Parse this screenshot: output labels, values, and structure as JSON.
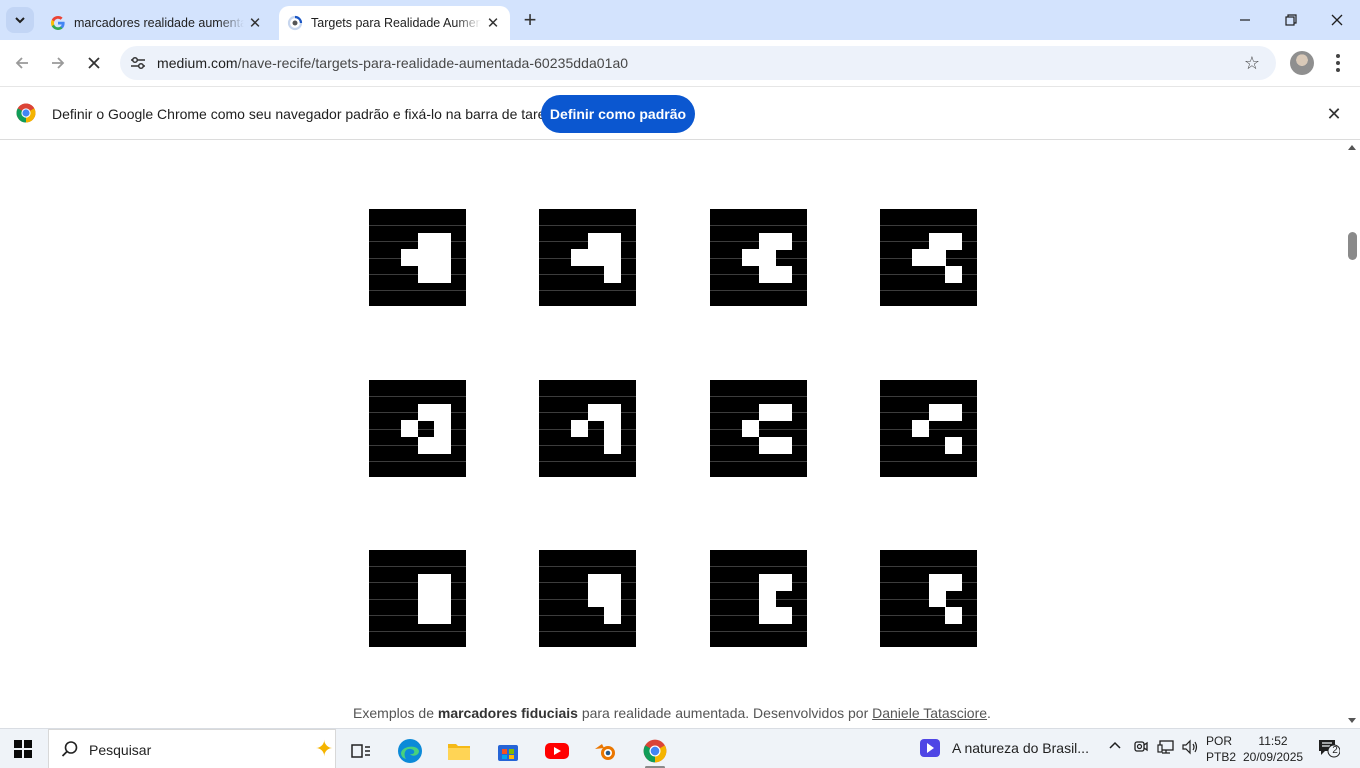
{
  "browser": {
    "tabs": [
      {
        "title": "marcadores realidade aumentada",
        "active": false,
        "favicon": "google-g-icon"
      },
      {
        "title": "Targets para Realidade Aumentada",
        "active": true,
        "favicon": "medium-loading-icon"
      }
    ],
    "url_domain": "medium.com",
    "url_path": "/nave-recife/targets-para-realidade-aumentada-60235dda01a0"
  },
  "infobar": {
    "message": "Definir o Google Chrome como seu navegador padrão e fixá-lo na barra de tarefas",
    "button_label": "Definir como padrão"
  },
  "article": {
    "markers": [
      {
        "pattern": [
          "0000",
          "0011",
          "0111",
          "0011",
          "0000"
        ]
      },
      {
        "pattern": [
          "0000",
          "0011",
          "0111",
          "0001",
          "0000"
        ]
      },
      {
        "pattern": [
          "0000",
          "0011",
          "0110",
          "0011",
          "0000"
        ]
      },
      {
        "pattern": [
          "0000",
          "0011",
          "0110",
          "0001",
          "0000"
        ]
      },
      {
        "pattern": [
          "0000",
          "0011",
          "0101",
          "0011",
          "0000"
        ]
      },
      {
        "pattern": [
          "0000",
          "0011",
          "0101",
          "0001",
          "0000"
        ]
      },
      {
        "pattern": [
          "0000",
          "0011",
          "0100",
          "0011",
          "0000"
        ]
      },
      {
        "pattern": [
          "0000",
          "0011",
          "0100",
          "0001",
          "0000"
        ]
      },
      {
        "pattern": [
          "0000",
          "0011",
          "0011",
          "0011",
          "0000"
        ]
      },
      {
        "pattern": [
          "0000",
          "0011",
          "0011",
          "0001",
          "0000"
        ]
      },
      {
        "pattern": [
          "0000",
          "0011",
          "0010",
          "0011",
          "0000"
        ]
      },
      {
        "pattern": [
          "0000",
          "0011",
          "0010",
          "0001",
          "0000"
        ]
      }
    ],
    "caption": {
      "prefix": "Exemplos de ",
      "bold": "marcadores fiduciais",
      "middle": " para realidade aumentada. Desenvolvidos por ",
      "link": "Daniele Tatasciore",
      "suffix": "."
    }
  },
  "taskbar": {
    "search_placeholder": "Pesquisar",
    "media_title": "A natureza do Brasil...",
    "language_line1": "POR",
    "language_line2": "PTB2",
    "time": "11:52",
    "date": "20/09/2025",
    "notification_count": "2"
  },
  "colors": {
    "tabstrip": "#d3e3fd",
    "accent_button": "#0b57d0",
    "omnibox": "#edf2fa"
  }
}
